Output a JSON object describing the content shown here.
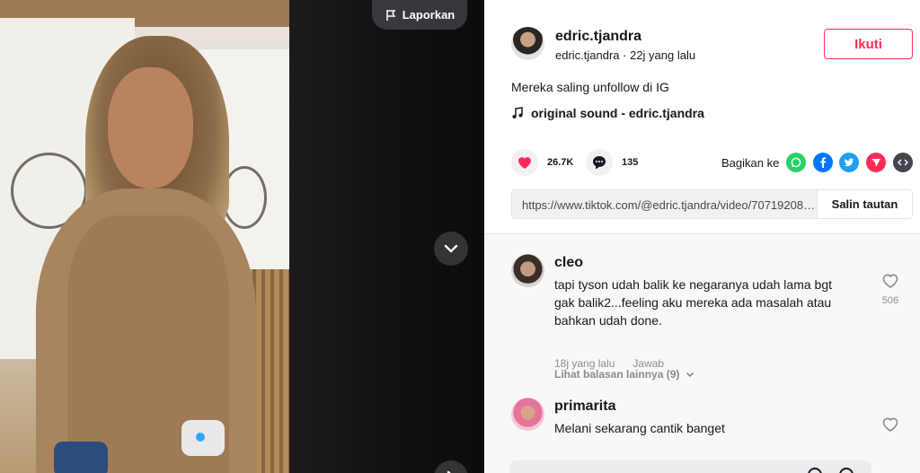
{
  "video": {
    "report_label": "Laporkan",
    "icons": {
      "report": "flag-icon",
      "down": "chevron-down-icon",
      "next": "chevron-right-icon"
    }
  },
  "author": {
    "username": "edric.tjandra",
    "meta": "edric.tjandra · 22j yang lalu",
    "follow_label": "Ikuti"
  },
  "caption": "Mereka saling unfollow di IG",
  "music": {
    "label": "original sound - edric.tjandra",
    "icon": "music-note-icon"
  },
  "actions": {
    "likes": "26.7K",
    "comments": "135",
    "share_label": "Bagikan ke",
    "share_targets": [
      "whatsapp-icon",
      "facebook-icon",
      "twitter-icon",
      "tiktok-send-icon",
      "embed-icon"
    ]
  },
  "link": {
    "url": "https://www.tiktok.com/@edric.tjandra/video/707192088...",
    "copy_label": "Salin tautan"
  },
  "comments": [
    {
      "user": "cleo",
      "text": "tapi tyson udah balik ke negaranya udah lama bgt gak balik2...feeling aku mereka ada masalah atau bahkan udah done.",
      "time": "18j yang lalu",
      "reply_label": "Jawab",
      "likes": "506",
      "more_replies": "Lihat balasan lainnya (9)"
    },
    {
      "user": "primarita",
      "text": "Melani sekarang cantik banget",
      "likes": ""
    }
  ],
  "colors": {
    "accent": "#fe2c55",
    "text": "#161823",
    "muted": "#8a8b91"
  }
}
